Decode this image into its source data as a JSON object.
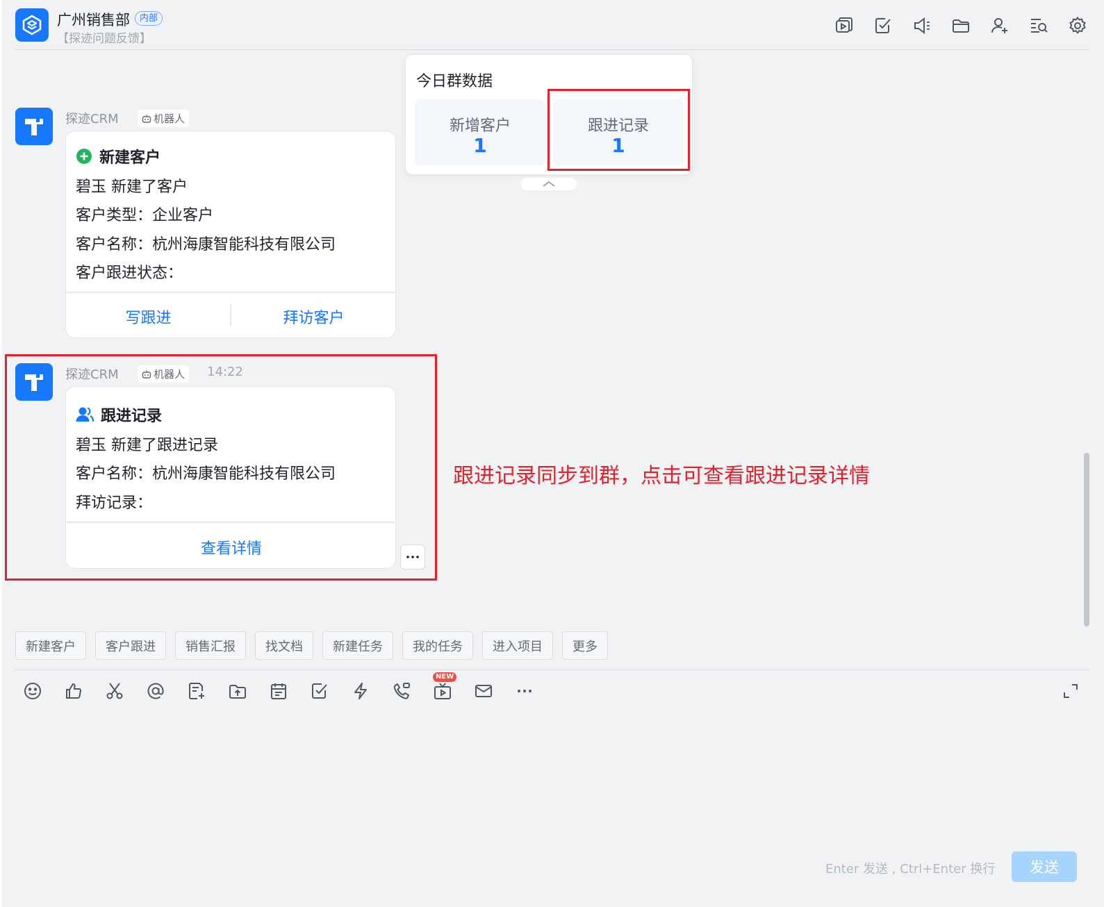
{
  "header": {
    "group_name": "广州销售部",
    "tag": "内部",
    "subtitle": "【探迹问题反馈】",
    "toolbar_icons": [
      "video-doc-icon",
      "task-check-icon",
      "announcement-icon",
      "folder-icon",
      "add-member-icon",
      "search-history-icon",
      "settings-icon"
    ]
  },
  "today_data": {
    "title": "今日群数据",
    "stats": [
      {
        "label": "新增客户",
        "value": "1"
      },
      {
        "label": "跟进记录",
        "value": "1"
      }
    ]
  },
  "messages": [
    {
      "sender": "探迹CRM",
      "tag": "机器人",
      "time": "",
      "card": {
        "title": "新建客户",
        "title_icon": "plus-circle-icon",
        "lines": [
          "碧玉 新建了客户",
          "客户类型：企业客户",
          "客户名称：杭州海康智能科技有限公司",
          "客户跟进状态："
        ],
        "actions": [
          "写跟进",
          "拜访客户"
        ]
      }
    },
    {
      "sender": "探迹CRM",
      "tag": "机器人",
      "time": "14:22",
      "card": {
        "title": "跟进记录",
        "title_icon": "user-group-icon",
        "lines": [
          "碧玉 新建了跟进记录",
          "客户名称：杭州海康智能科技有限公司",
          "拜访记录："
        ],
        "actions": [
          "查看详情"
        ]
      }
    }
  ],
  "annotation": "跟进记录同步到群，点击可查看跟进记录详情",
  "quick_actions": [
    "新建客户",
    "客户跟进",
    "销售汇报",
    "找文档",
    "新建任务",
    "我的任务",
    "进入项目",
    "更多"
  ],
  "composer": {
    "icons": [
      "emoji-icon",
      "thumbs-up-icon",
      "scissors-icon",
      "mention-icon",
      "note-add-icon",
      "upload-icon",
      "calendar-icon",
      "checkbox-icon",
      "lightning-icon",
      "phone-icon",
      "live-video-icon",
      "mail-icon",
      "more-icon"
    ],
    "new_badge": "NEW",
    "hint": "Enter 发送 , Ctrl+Enter 换行",
    "send_label": "发送"
  },
  "colors": {
    "accent": "#1677ff",
    "annotation_red": "#e0232f",
    "send_disabled": "#a6d4ff",
    "success_green": "#21b65a"
  }
}
